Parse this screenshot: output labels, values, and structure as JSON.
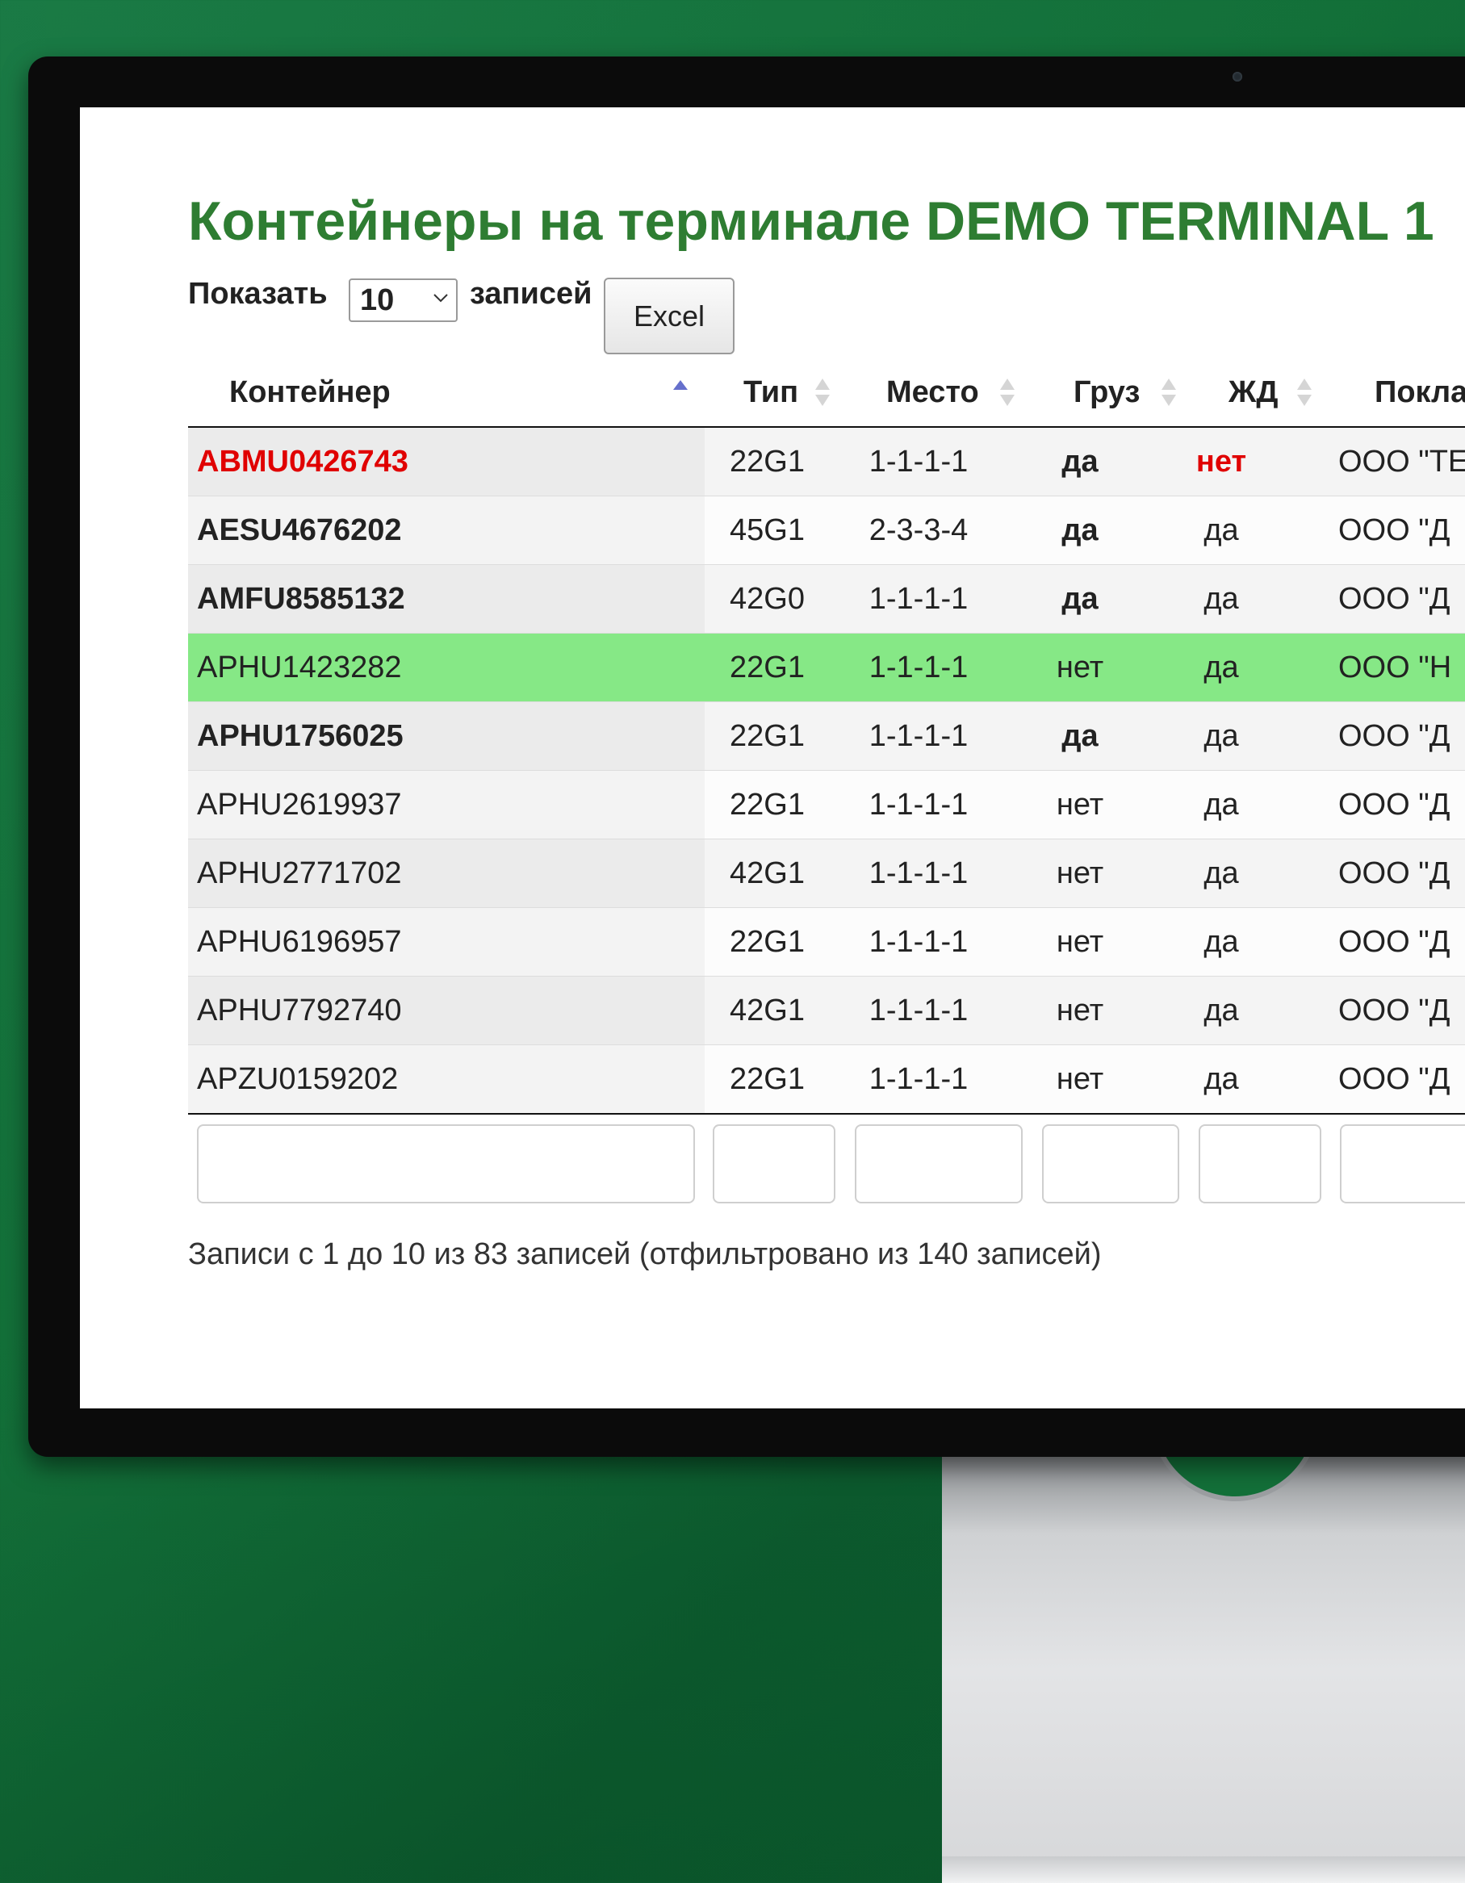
{
  "page": {
    "title": "Контейнеры на терминале DEMO TERMINAL 1"
  },
  "controls": {
    "show_label": "Показать",
    "page_size": "10",
    "records_label": "записей",
    "excel_label": "Excel"
  },
  "table": {
    "columns": [
      "Контейнер",
      "Тип",
      "Место",
      "Груз",
      "ЖД",
      "Покла"
    ],
    "sorted_column": "Контейнер",
    "sort_direction": "asc",
    "rows": [
      {
        "container": "ABMU0426743",
        "type": "22G1",
        "place": "1-1-1-1",
        "cargo": "да",
        "rail": "нет",
        "owner": "ООО \"ТЕ"
      },
      {
        "container": "AESU4676202",
        "type": "45G1",
        "place": "2-3-3-4",
        "cargo": "да",
        "rail": "да",
        "owner": "ООО \"Д"
      },
      {
        "container": "AMFU8585132",
        "type": "42G0",
        "place": "1-1-1-1",
        "cargo": "да",
        "rail": "да",
        "owner": "ООО \"Д"
      },
      {
        "container": "APHU1423282",
        "type": "22G1",
        "place": "1-1-1-1",
        "cargo": "нет",
        "rail": "да",
        "owner": "ООО \"Н"
      },
      {
        "container": "APHU1756025",
        "type": "22G1",
        "place": "1-1-1-1",
        "cargo": "да",
        "rail": "да",
        "owner": "ООО \"Д"
      },
      {
        "container": "APHU2619937",
        "type": "22G1",
        "place": "1-1-1-1",
        "cargo": "нет",
        "rail": "да",
        "owner": "ООО \"Д"
      },
      {
        "container": "APHU2771702",
        "type": "42G1",
        "place": "1-1-1-1",
        "cargo": "нет",
        "rail": "да",
        "owner": "ООО \"Д"
      },
      {
        "container": "APHU6196957",
        "type": "22G1",
        "place": "1-1-1-1",
        "cargo": "нет",
        "rail": "да",
        "owner": "ООО \"Д"
      },
      {
        "container": "APHU7792740",
        "type": "42G1",
        "place": "1-1-1-1",
        "cargo": "нет",
        "rail": "да",
        "owner": "ООО \"Д"
      },
      {
        "container": "APZU0159202",
        "type": "22G1",
        "place": "1-1-1-1",
        "cargo": "нет",
        "rail": "да",
        "owner": "ООО \"Д"
      }
    ]
  },
  "info": "Записи с 1 до 10 из 83 записей (отфильтровано из 140 записей)",
  "colors": {
    "title_green": "#2e7d32",
    "highlight_row": "#86e886",
    "alert_red": "#e00000",
    "background_green": "#137039"
  }
}
